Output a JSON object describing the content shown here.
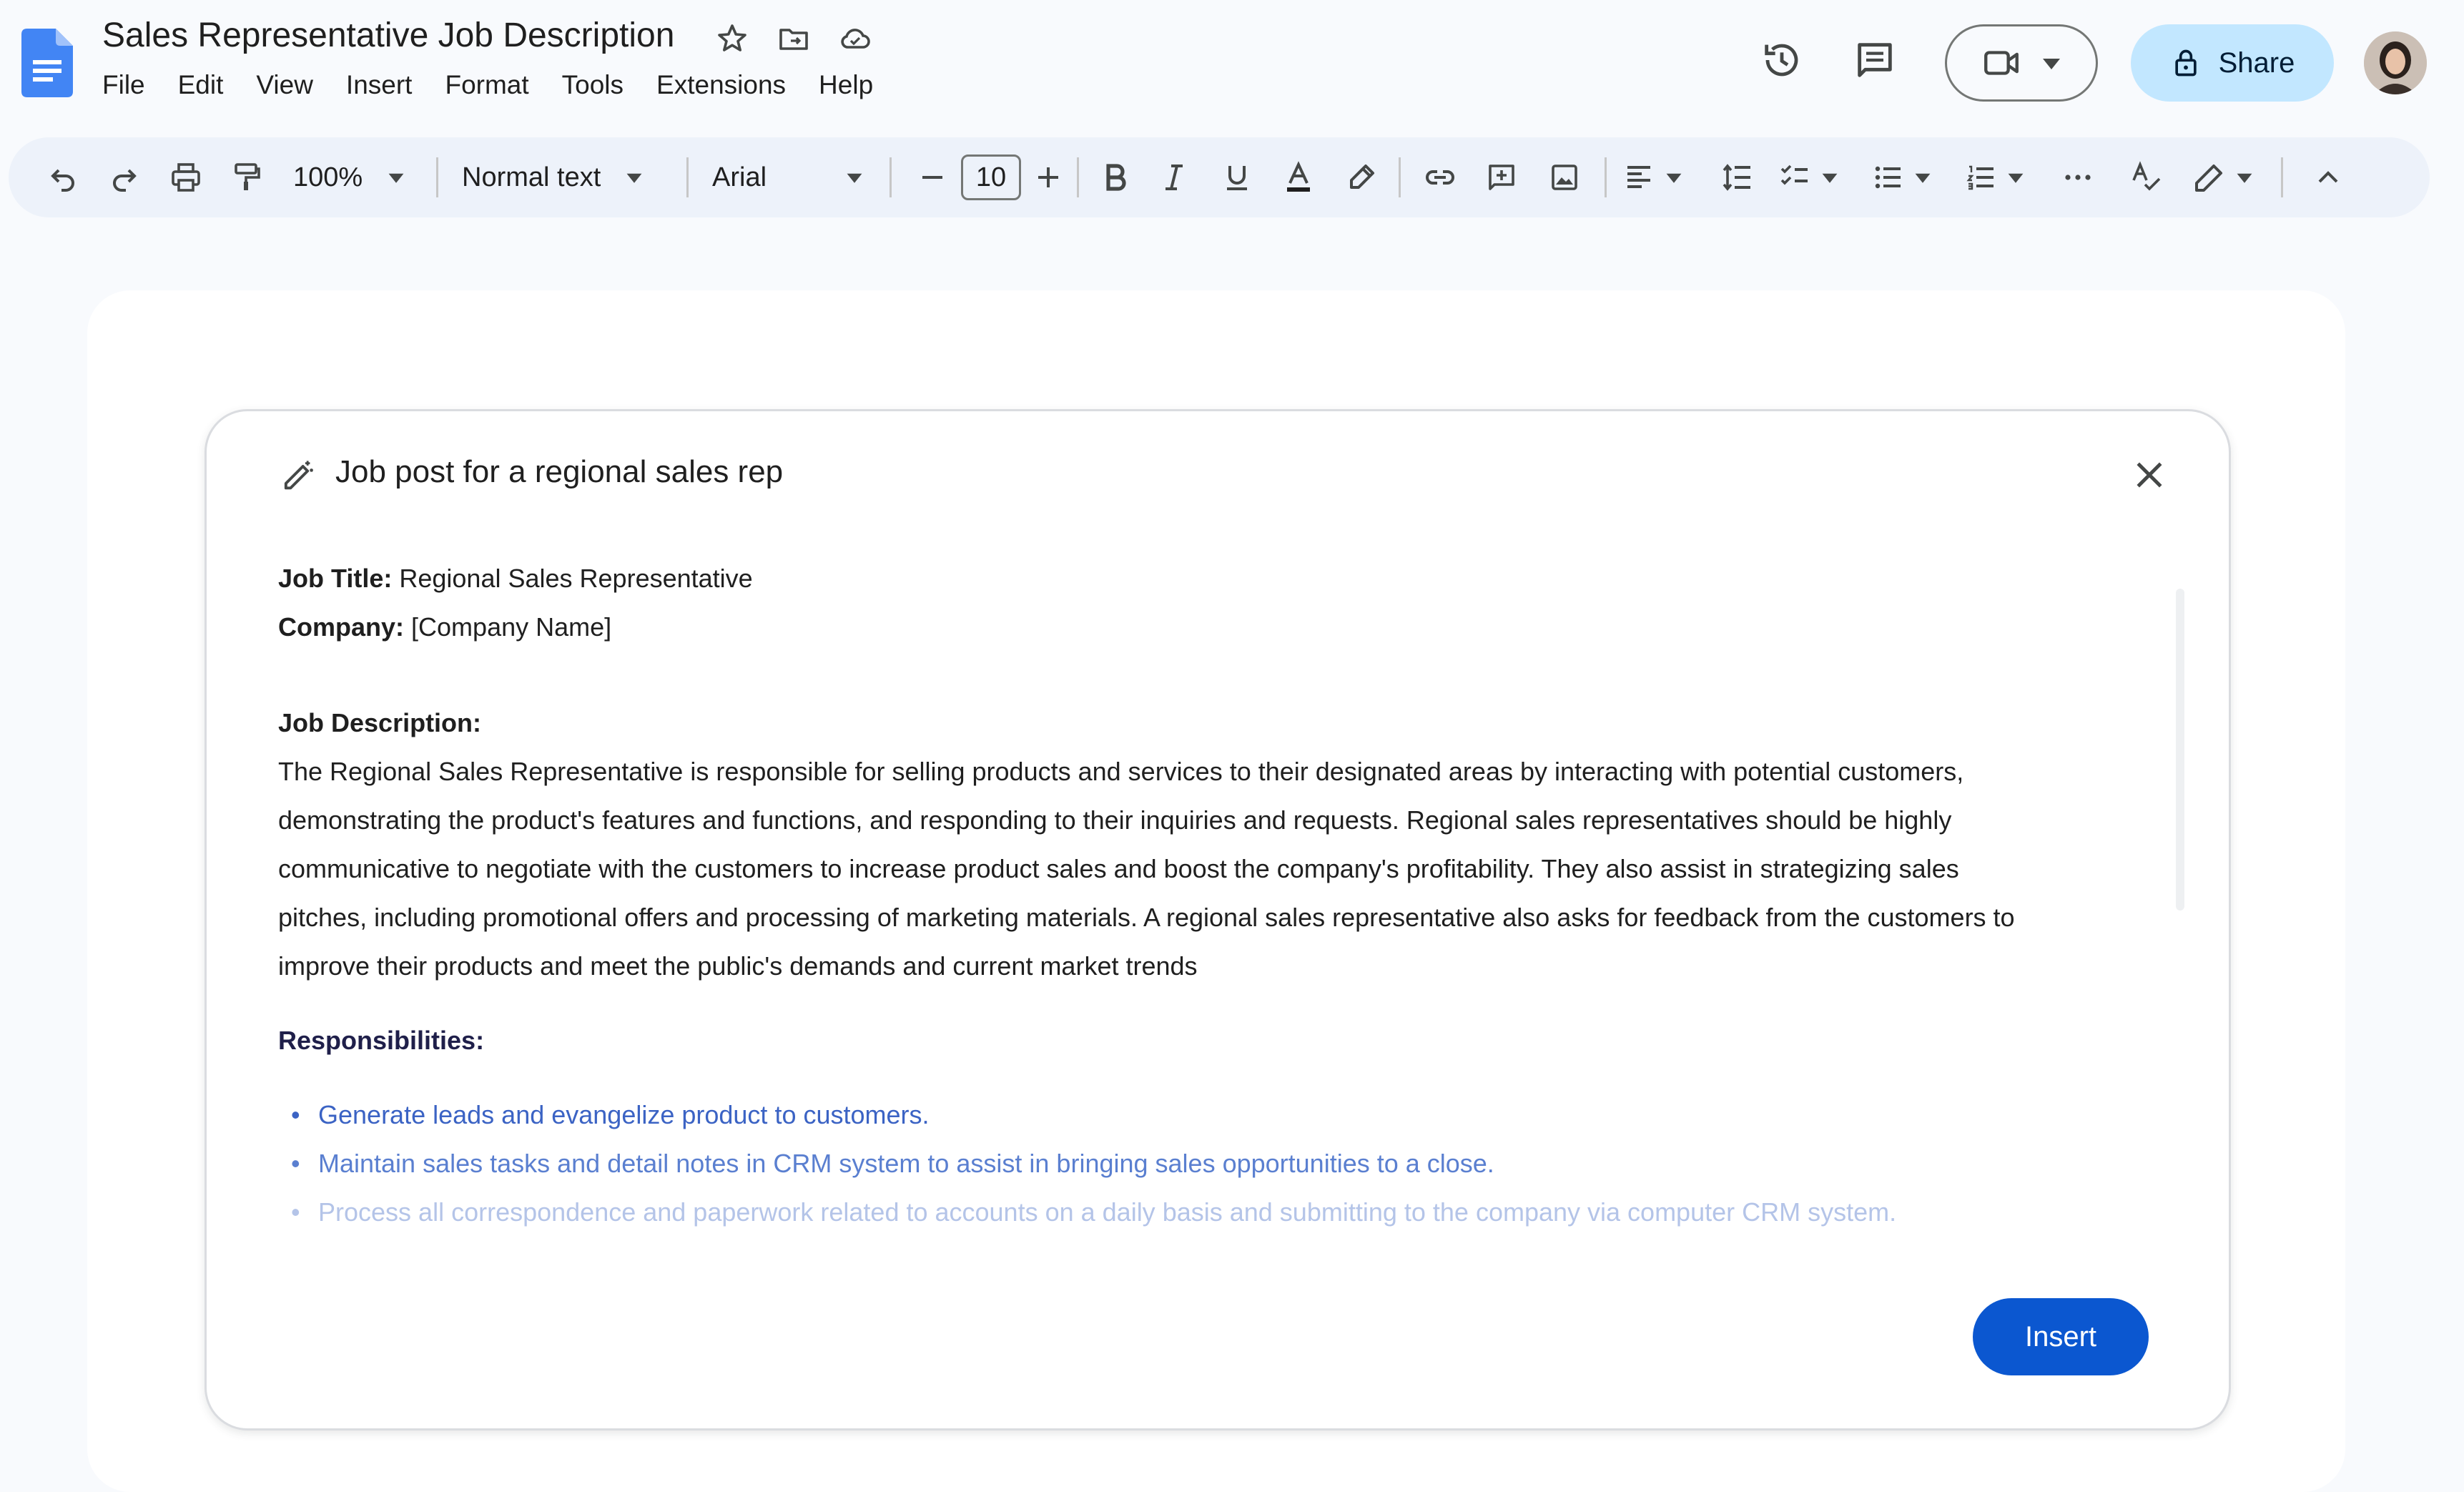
{
  "doc": {
    "title": "Sales Representative Job Description",
    "menu": [
      "File",
      "Edit",
      "View",
      "Insert",
      "Format",
      "Tools",
      "Extensions",
      "Help"
    ]
  },
  "header": {
    "share_label": "Share"
  },
  "toolbar": {
    "zoom": "100%",
    "style": "Normal text",
    "font": "Arial",
    "font_size": "10"
  },
  "dialog": {
    "prompt": "Job post for a regional sales rep",
    "job_title_label": "Job Title:",
    "job_title_value": "Regional Sales Representative",
    "company_label": "Company:",
    "company_value": "[Company Name]",
    "description_heading": "Job Description:",
    "description_lines": [
      "The Regional Sales Representative is responsible for selling products and services to their designated areas by interacting with potential customers,",
      "demonstrating the product's features and functions, and responding to their inquiries and requests. Regional sales representatives should be highly",
      "communicative to negotiate with the customers to increase product sales and boost the company's profitability. They also assist in strategizing sales",
      "pitches, including promotional offers and processing of marketing materials. A regional sales representative also asks for feedback from the customers to",
      "improve their products and meet the public's demands and current market trends"
    ],
    "responsibilities_heading": "Responsibilities:",
    "responsibilities": [
      "Generate leads and evangelize product to customers.",
      "Maintain sales tasks and detail notes in CRM system to assist in bringing sales opportunities to a close.",
      "Process all correspondence and paperwork related to accounts on a daily basis and submitting to the company via computer CRM system."
    ],
    "insert_label": "Insert"
  },
  "colors": {
    "accent": "#0b57d0",
    "share_bg": "#c2e7ff",
    "toolbar_bg": "#edf2fa",
    "app_bg": "#f8fafd"
  }
}
